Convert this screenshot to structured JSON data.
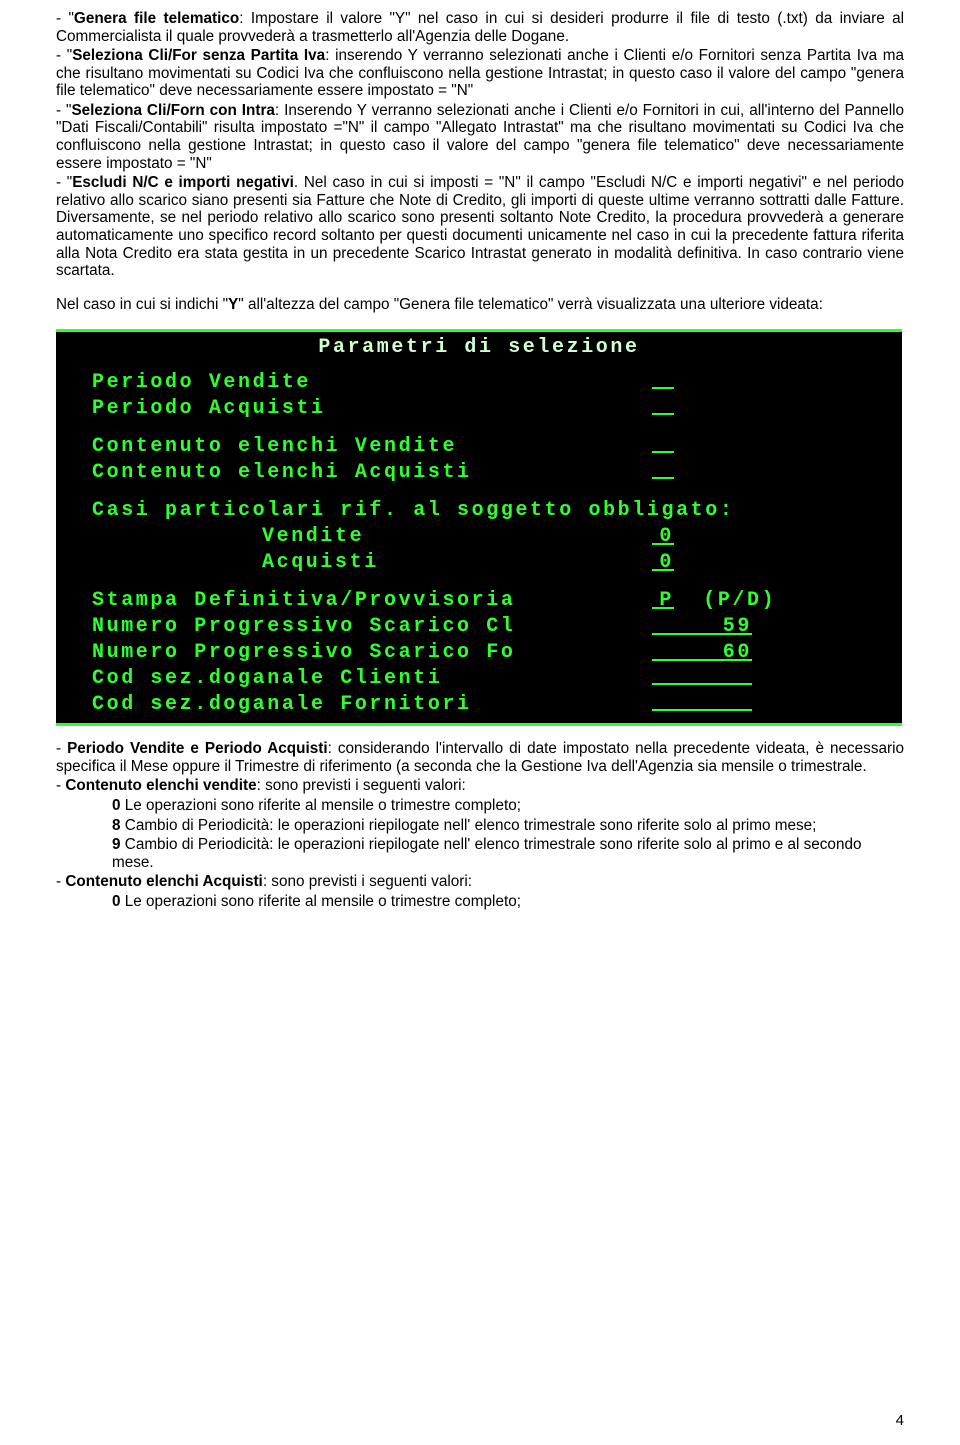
{
  "body": {
    "p1a_bold": "Genera file telematico",
    "p1a_rest": ": Impostare il valore \"Y\" nel caso in cui si desideri produrre il file di testo (.txt) da inviare al Commercialista il quale provvederà a trasmetterlo all'Agenzia delle Dogane.",
    "p2_bold": "Seleziona Cli/For  senza Partita Iva",
    "p2_rest": ": inserendo Y verranno selezionati anche i  Clienti e/o Fornitori senza Partita Iva ma che risultano movimentati su Codici Iva che confluiscono nella gestione Intrastat;  in questo caso il valore del campo \"genera file telematico\" deve necessariamente  essere impostato = \"N\"",
    "p3_bold": "Seleziona Cli/Forn con Intra",
    "p3_rest": ": Inserendo Y verranno selezionati anche i Clienti e/o Fornitori in cui, all'interno del Pannello \"Dati Fiscali/Contabili\" risulta impostato =\"N\" il campo \"Allegato Intrastat\" ma che risultano movimentati su Codici Iva che  confluiscono nella gestione Intrastat;  in questo caso il valore del campo \"genera file telematico\" deve necessariamente  essere impostato = \"N\"",
    "p4_bold": "Escludi N/C e importi negativi",
    "p4_rest": ". Nel caso in cui si imposti = \"N\" il campo \"Escludi N/C e importi negativi\" e nel periodo relativo allo scarico siano presenti sia Fatture che Note di Credito, gli importi di queste ultime verranno sottratti dalle Fatture. Diversamente, se nel periodo relativo allo scarico sono presenti soltanto Note Credito, la procedura provvederà a generare automaticamente uno specifico record soltanto per questi documenti unicamente nel caso in cui la precedente fattura riferita alla Nota Credito era stata gestita in un precedente Scarico Intrastat generato in modalità definitiva. In caso contrario viene scartata.",
    "p5_pre": "Nel caso in cui si indichi \"",
    "p5_bold": "Y",
    "p5_post": "\" all'altezza del campo \"Genera file telematico\" verrà visualizzata  una ulteriore videata:"
  },
  "terminal": {
    "title": "Parametri di selezione",
    "rows": {
      "periodo_vendite": "Periodo Vendite",
      "periodo_acquisti": "Periodo Acquisti",
      "contenuto_vendite": "Contenuto elenchi Vendite",
      "contenuto_acquisti": "Contenuto elenchi Acquisti",
      "casi_particolari": "Casi particolari rif. al soggetto obbligato:",
      "vendite": "Vendite",
      "acquisti": "Acquisti",
      "vendite_val": "0",
      "acquisti_val": "0",
      "stampa_lbl": "Stampa Definitiva/Provvisoria",
      "stampa_val": "P",
      "stampa_suffix": "(P/D)",
      "num_prog_cl_lbl": "Numero Progressivo Scarico Cl",
      "num_prog_cl_val": "59",
      "num_prog_fo_lbl": "Numero Progressivo Scarico Fo",
      "num_prog_fo_val": "60",
      "cod_sez_cl": "Cod sez.doganale Clienti",
      "cod_sez_fo": "Cod sez.doganale Fornitori"
    }
  },
  "after": {
    "p6_bold": "Periodo Vendite e Periodo Acquisti",
    "p6_rest": ": considerando l'intervallo di date impostato nella precedente videata, è necessario specifica il Mese oppure il Trimestre di riferimento (a seconda che la Gestione Iva dell'Agenzia sia mensile o trimestrale.",
    "p7_bold": "Contenuto elenchi vendite",
    "p7_rest": ": sono previsti i seguenti valori:",
    "p7_items": [
      {
        "n": "0",
        "t": "Le operazioni sono riferite al mensile o trimestre completo;"
      },
      {
        "n": "8",
        "t": "Cambio di Periodicità: le operazioni riepilogate nell' elenco trimestrale sono riferite solo al primo mese;"
      },
      {
        "n": "9",
        "t": "Cambio di Periodicità: le operazioni riepilogate nell' elenco trimestrale sono riferite solo al primo e al secondo mese."
      }
    ],
    "p8_bold": "Contenuto elenchi Acquisti",
    "p8_rest": ": sono previsti i seguenti valori:",
    "p8_items": [
      {
        "n": "0",
        "t": "Le operazioni sono riferite al mensile o trimestre completo;"
      }
    ]
  },
  "pagenum": "4"
}
